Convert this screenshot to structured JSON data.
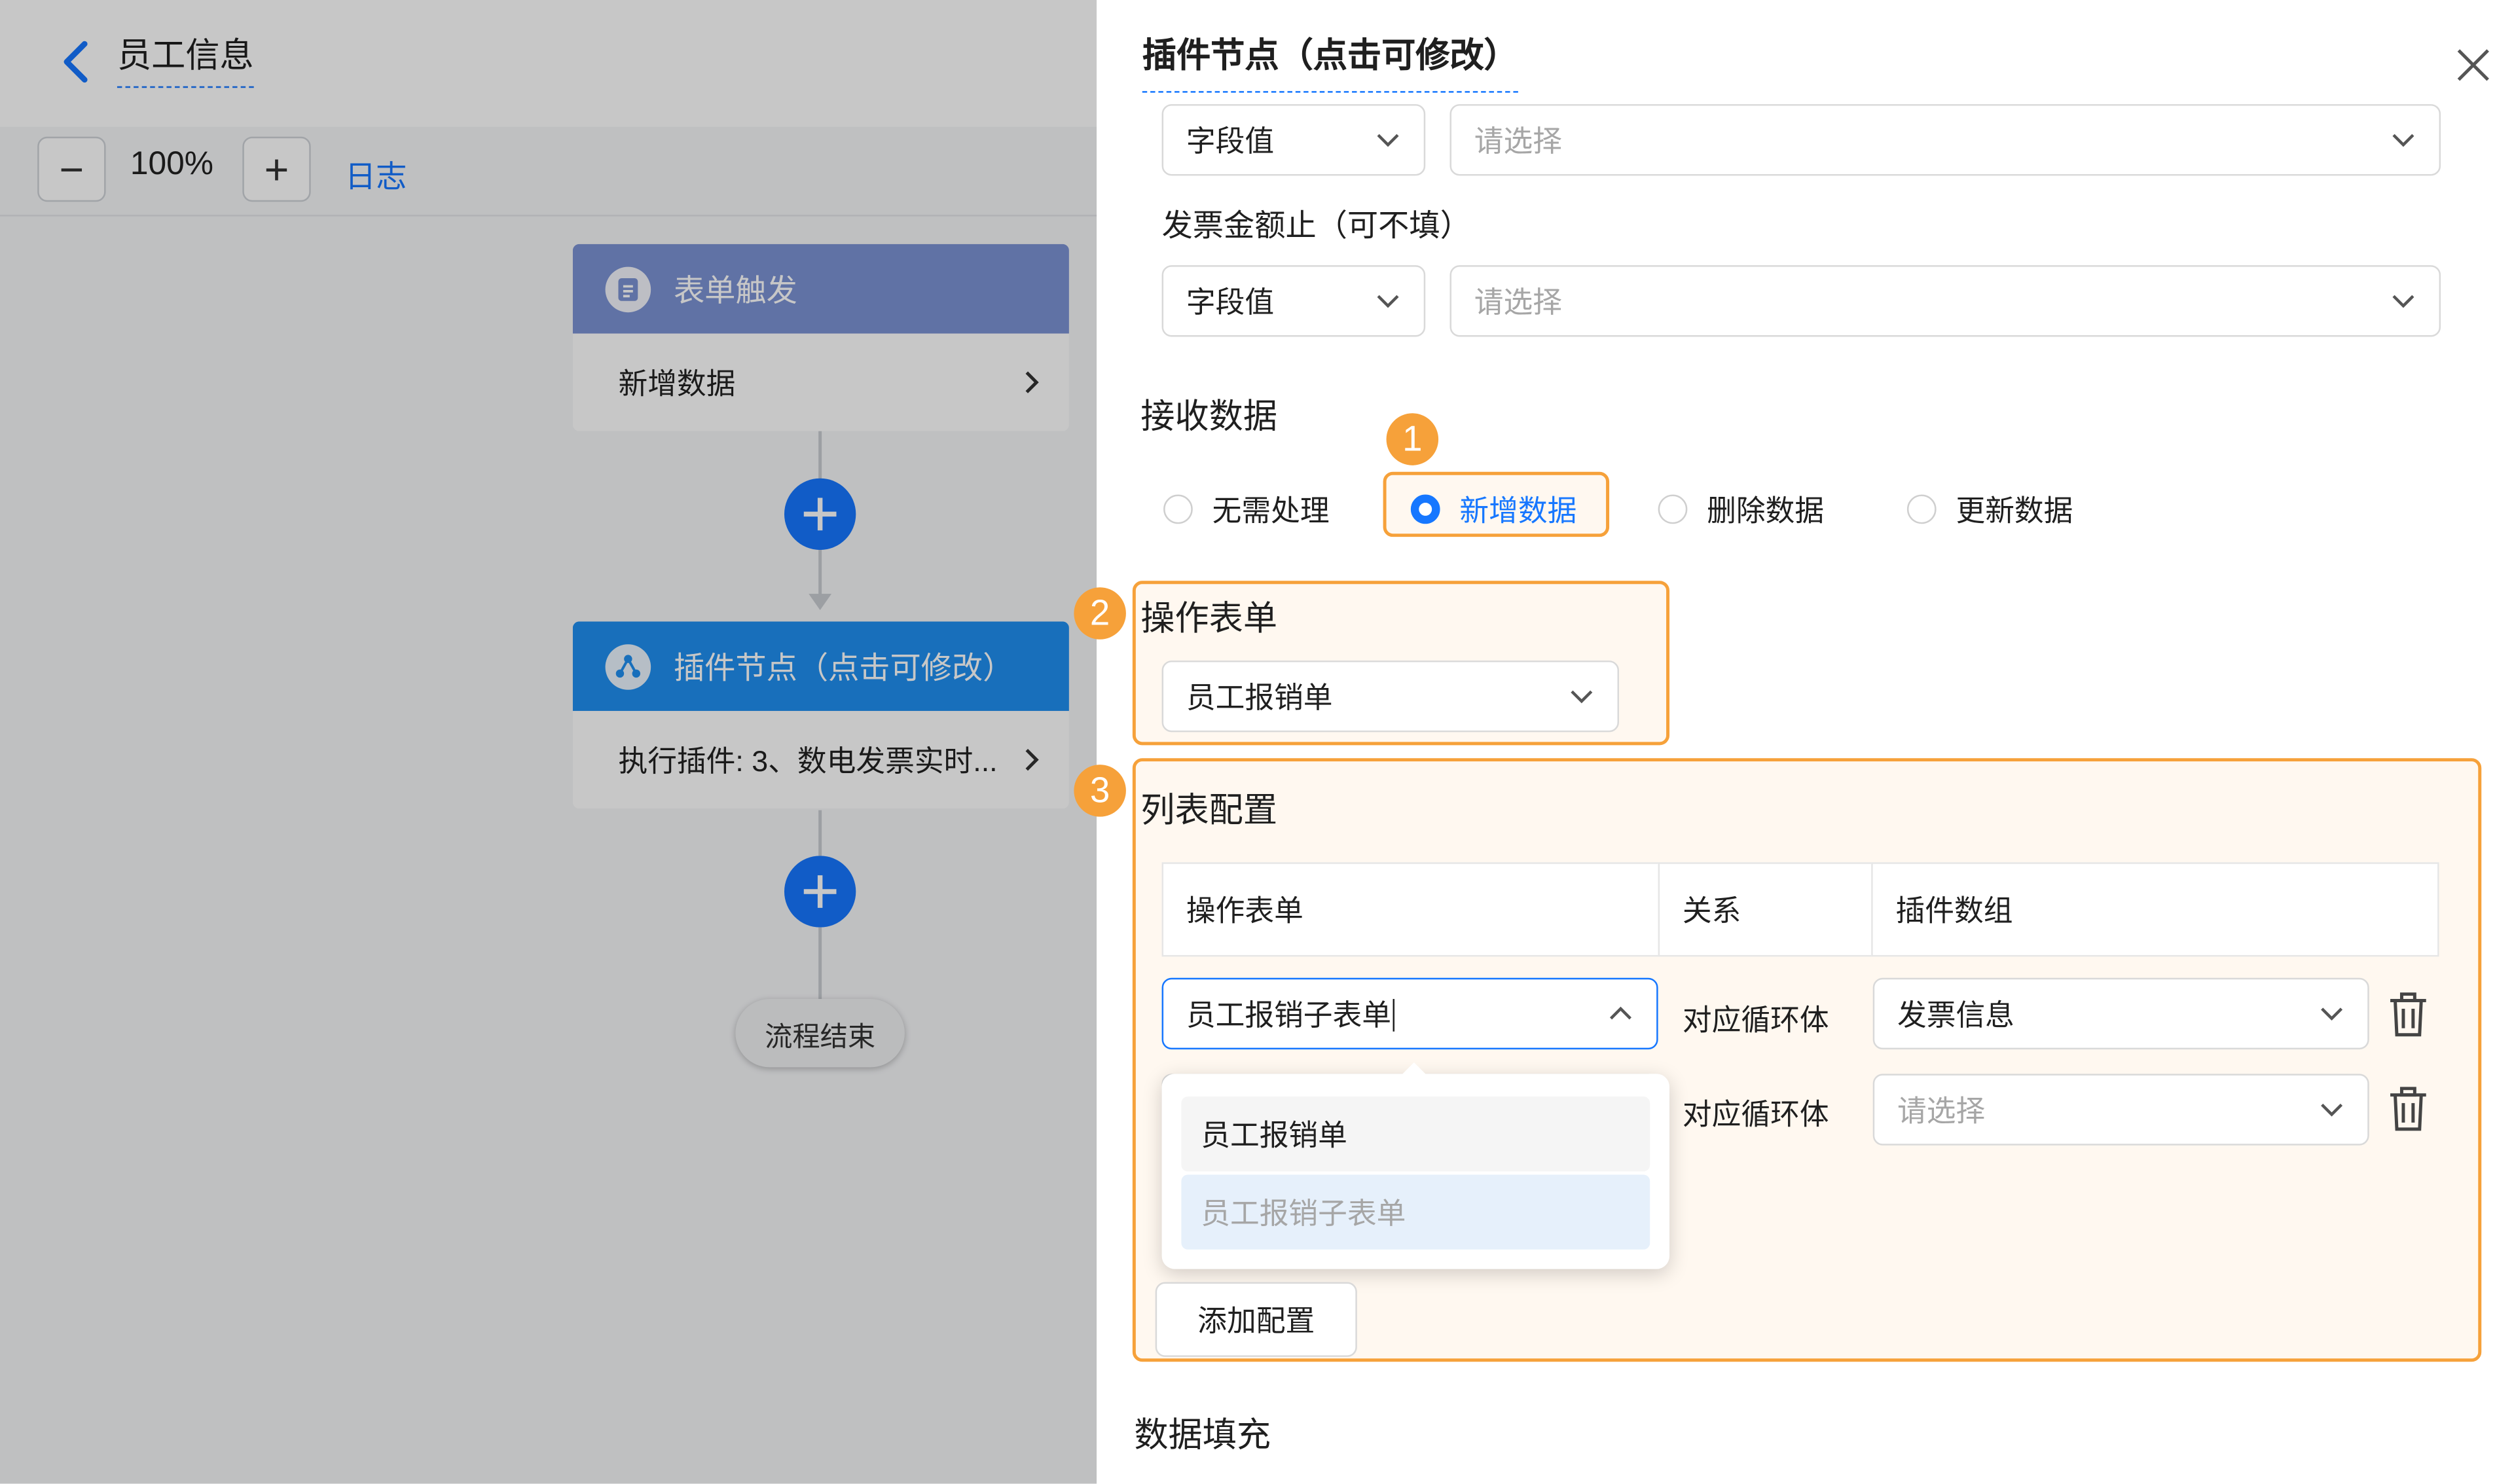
{
  "header": {
    "title": "员工信息"
  },
  "toolbar": {
    "zoom_out": "−",
    "zoom_level": "100%",
    "zoom_in": "+",
    "log_label": "日志"
  },
  "flow": {
    "trigger_node": {
      "title": "表单触发",
      "body": "新增数据"
    },
    "plugin_node": {
      "title": "插件节点（点击可修改）",
      "body": "执行插件: 3、数电发票实时..."
    },
    "end_label": "流程结束"
  },
  "drawer": {
    "title": "插件节点（点击可修改）",
    "field_rows": [
      {
        "label": "",
        "type_value": "字段值",
        "placeholder": "请选择"
      },
      {
        "label": "发票金额止（可不填）",
        "type_value": "字段值",
        "placeholder": "请选择"
      }
    ],
    "receive": {
      "title": "接收数据",
      "badge": "1",
      "options": [
        {
          "label": "无需处理",
          "checked": false
        },
        {
          "label": "新增数据",
          "checked": true
        },
        {
          "label": "删除数据",
          "checked": false
        },
        {
          "label": "更新数据",
          "checked": false
        }
      ]
    },
    "form_section": {
      "badge": "2",
      "title": "操作表单",
      "value": "员工报销单"
    },
    "list_config": {
      "badge": "3",
      "title": "列表配置",
      "headers": [
        "操作表单",
        "关系",
        "插件数组"
      ],
      "rows": [
        {
          "form": "员工报销子表单",
          "relation": "对应循环体",
          "array": "发票信息",
          "array_placeholder": ""
        },
        {
          "form": "",
          "relation": "对应循环体",
          "array": "",
          "array_placeholder": "请选择"
        }
      ],
      "dropdown_options": [
        "员工报销单",
        "员工报销子表单"
      ],
      "add_button": "添加配置"
    },
    "fill_title": "数据填充"
  },
  "colors": {
    "accent": "#1677ff",
    "highlight": "#f6a13a",
    "trigger_header": "#7b92d4",
    "plugin_header": "#1f8ff0"
  }
}
